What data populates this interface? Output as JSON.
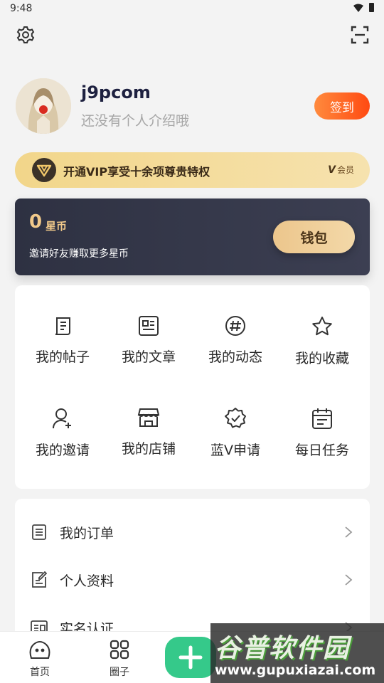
{
  "status_bar": {
    "time": "9:48"
  },
  "profile": {
    "username": "j9pcom",
    "bio": "还没有个人介绍哦",
    "checkin_label": "签到"
  },
  "vip": {
    "text": "开通VIP享受十余项尊贵特权",
    "badge_v": "V",
    "badge_label": "会员"
  },
  "coins": {
    "value": "0",
    "unit": "星币",
    "tip": "邀请好友赚取更多星币",
    "wallet_label": "钱包"
  },
  "grid": {
    "items": [
      {
        "label": "我的帖子",
        "icon": "post-icon"
      },
      {
        "label": "我的文章",
        "icon": "article-icon"
      },
      {
        "label": "我的动态",
        "icon": "hashtag-icon"
      },
      {
        "label": "我的收藏",
        "icon": "star-icon"
      },
      {
        "label": "我的邀请",
        "icon": "invite-user-icon"
      },
      {
        "label": "我的店铺",
        "icon": "store-icon"
      },
      {
        "label": "蓝V申请",
        "icon": "verified-badge-icon"
      },
      {
        "label": "每日任务",
        "icon": "calendar-icon"
      }
    ]
  },
  "list": {
    "items": [
      {
        "label": "我的订单",
        "icon": "order-icon"
      },
      {
        "label": "个人资料",
        "icon": "edit-profile-icon"
      },
      {
        "label": "实名认证",
        "icon": "id-card-icon"
      }
    ]
  },
  "nav": {
    "items": [
      {
        "label": "首页",
        "icon": "home-icon"
      },
      {
        "label": "圈子",
        "icon": "circles-icon"
      }
    ]
  },
  "watermark": {
    "title": "谷普软件园",
    "url": "www.gupuxiazai.com"
  },
  "colors": {
    "accent_orange": "#ff5a1f",
    "vip_gold": "#f2d68a",
    "coin_card": "#33364a",
    "add_green": "#35c98a"
  }
}
